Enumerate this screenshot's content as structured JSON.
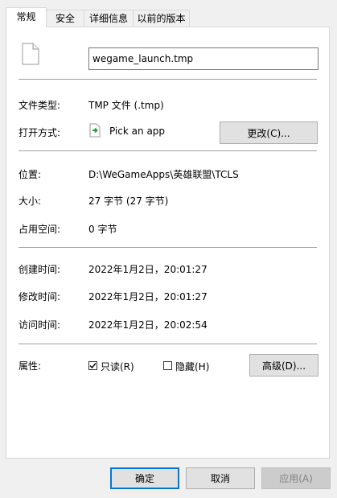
{
  "tabs": [
    {
      "label": "常规"
    },
    {
      "label": "安全"
    },
    {
      "label": "详细信息"
    },
    {
      "label": "以前的版本"
    }
  ],
  "file": {
    "name": "wegame_launch.tmp"
  },
  "props": {
    "type_label": "文件类型:",
    "type_value": "TMP 文件 (.tmp)",
    "opens_label": "打开方式:",
    "opens_value": "Pick an app",
    "change_button": "更改(C)...",
    "location_label": "位置:",
    "location_value": "D:\\WeGameApps\\英雄联盟\\TCLS",
    "size_label": "大小:",
    "size_value": "27 字节 (27 字节)",
    "disk_label": "占用空间:",
    "disk_value": "0 字节",
    "created_label": "创建时间:",
    "created_value": "2022年1月2日，20:01:27",
    "modified_label": "修改时间:",
    "modified_value": "2022年1月2日，20:01:27",
    "accessed_label": "访问时间:",
    "accessed_value": "2022年1月2日，20:02:54",
    "attr_label": "属性:",
    "readonly_label": "只读(R)",
    "readonly_checked": true,
    "hidden_label": "隐藏(H)",
    "hidden_checked": false,
    "advanced_button": "高级(D)..."
  },
  "footer": {
    "ok": "确定",
    "cancel": "取消",
    "apply": "应用(A)"
  }
}
